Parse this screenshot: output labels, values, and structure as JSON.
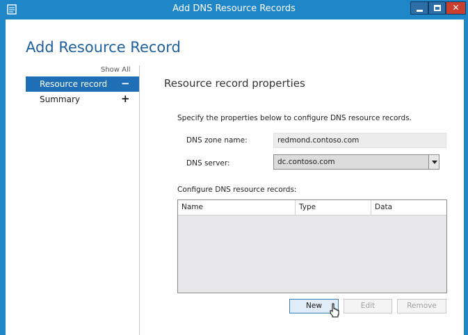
{
  "window": {
    "title": "Add DNS Resource Records",
    "controls": {
      "minimize": "minimize",
      "maximize": "maximize",
      "close": "✕"
    }
  },
  "page": {
    "title": "Add Resource Record"
  },
  "nav": {
    "show_all": "Show All",
    "items": [
      {
        "label": "Resource record",
        "sign": "−",
        "active": true
      },
      {
        "label": "Summary",
        "sign": "+",
        "active": false
      }
    ]
  },
  "main": {
    "section_title": "Resource record properties",
    "description": "Specify the properties below to configure DNS resource records.",
    "zone": {
      "label": "DNS zone name:",
      "value": "redmond.contoso.com"
    },
    "server": {
      "label": "DNS server:",
      "value": "dc.contoso.com"
    },
    "records_label": "Configure DNS resource records:",
    "grid": {
      "columns": [
        "Name",
        "Type",
        "Data"
      ],
      "rows": []
    },
    "buttons": {
      "new": "New",
      "edit": "Edit",
      "remove": "Remove"
    }
  },
  "colors": {
    "titlebar": "#1f86c7",
    "accent": "#1e6fb5",
    "title_text": "#1f5f9c",
    "close": "#c9402f"
  }
}
